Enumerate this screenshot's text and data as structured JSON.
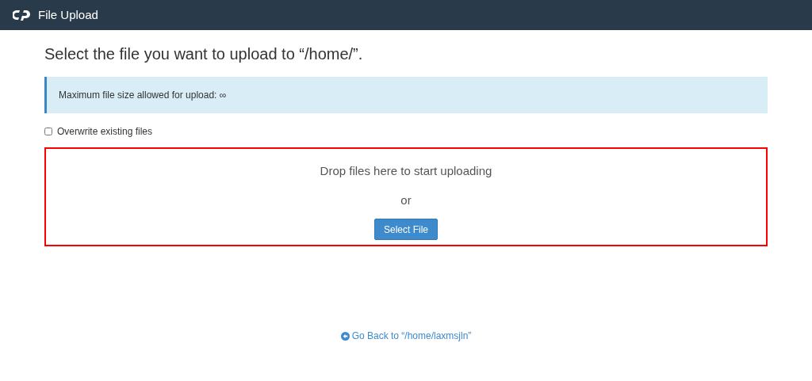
{
  "header": {
    "title": "File Upload"
  },
  "heading": "Select the file you want to upload to “/home/”.",
  "alert": "Maximum file size allowed for upload: ∞",
  "overwrite": {
    "label": "Overwrite existing files",
    "checked": false
  },
  "dropzone": {
    "prompt": "Drop files here to start uploading",
    "or": "or",
    "button": "Select File"
  },
  "back_link": "Go Back to “/home/laxmsjln”"
}
